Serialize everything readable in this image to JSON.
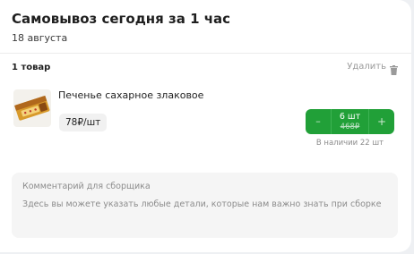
{
  "header": {
    "title": "Самовывоз сегодня за 1 час",
    "date": "18 августа"
  },
  "cart": {
    "items_count": "1 товар",
    "delete_label": "Удалить",
    "delete_icon": "trash-icon"
  },
  "product": {
    "name": "Печенье сахарное злаковое",
    "price": "78₽/шт",
    "image_icon": "cookie-pack-image",
    "quantity": "6 шт",
    "old_total": "468₽",
    "minus_label": "–",
    "plus_label": "+",
    "stock": "В наличии 22 шт"
  },
  "comment": {
    "label": "Комментарий для сборщика",
    "placeholder": "Здесь вы можете указать любые детали, которые нам важно знать при сборке"
  },
  "colors": {
    "accent": "#21a038",
    "background": "#ffffff",
    "muted": "#8c8c8c"
  }
}
